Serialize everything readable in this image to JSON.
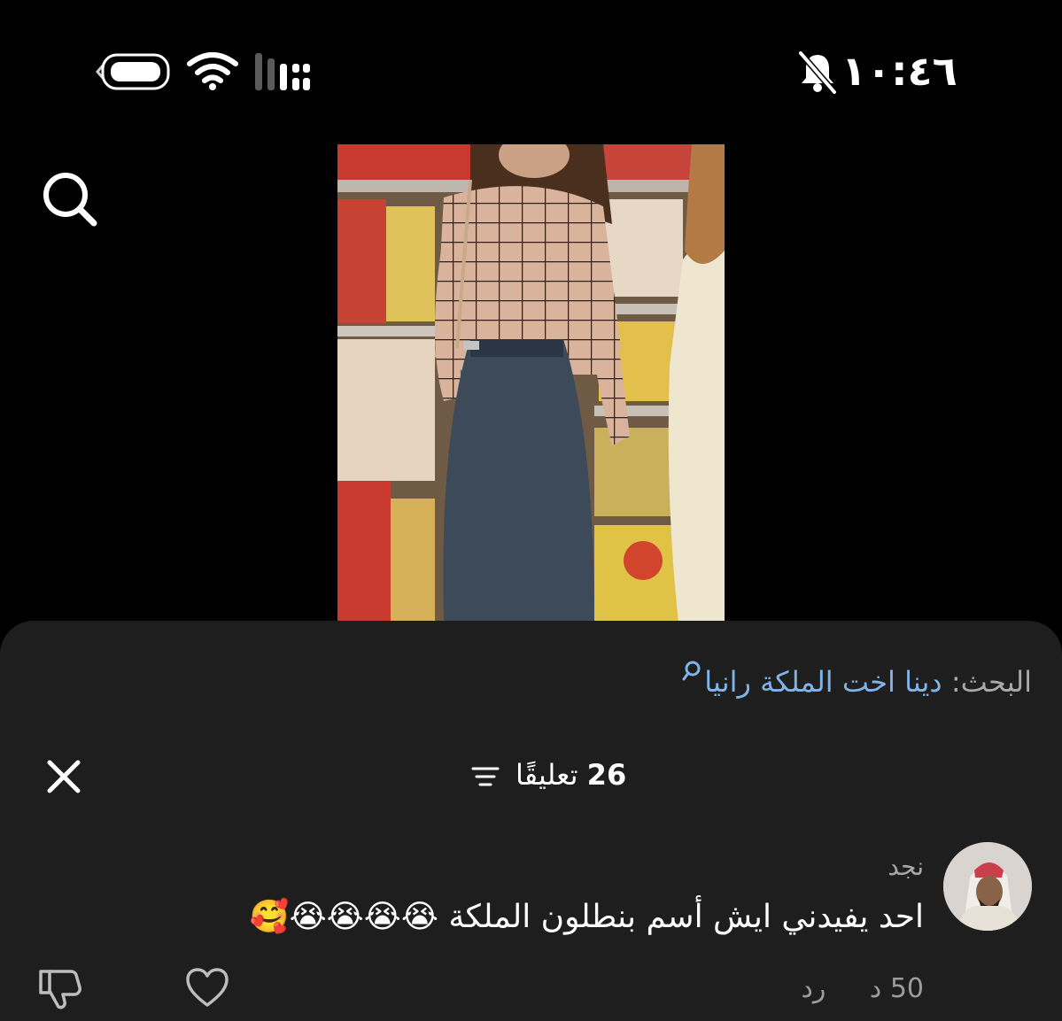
{
  "status_bar": {
    "time": "١٠:٤٦",
    "battery_icon": "battery-icon",
    "wifi_icon": "wifi-icon",
    "signal_icon": "cellular-signal-icon",
    "mute_icon": "bell-muted-icon"
  },
  "top_bar": {
    "search_icon": "search-icon"
  },
  "video": {
    "thumbnail": "woman-in-checked-top-and-denim-skirt-in-toy-store"
  },
  "comments_sheet": {
    "search_label": "البحث:",
    "search_query": "دينا اخت الملكة رانيا",
    "comments_count": "26",
    "comments_label": "تعليقًا",
    "filter_icon": "filter-icon",
    "close_icon": "close-icon",
    "comments": [
      {
        "author": "نجد",
        "text": "احد يفيدني ايش أسم بنطلون الملكة 😭😭😭😭🥰",
        "time_ago": "50 د",
        "reply_label": "رد",
        "like_icon": "heart-icon",
        "dislike_icon": "thumbs-down-icon"
      }
    ]
  },
  "colors": {
    "background": "#000000",
    "sheet": "#1e1e1e",
    "link": "#7fb3ea",
    "secondary_text": "#a9a9a9"
  }
}
